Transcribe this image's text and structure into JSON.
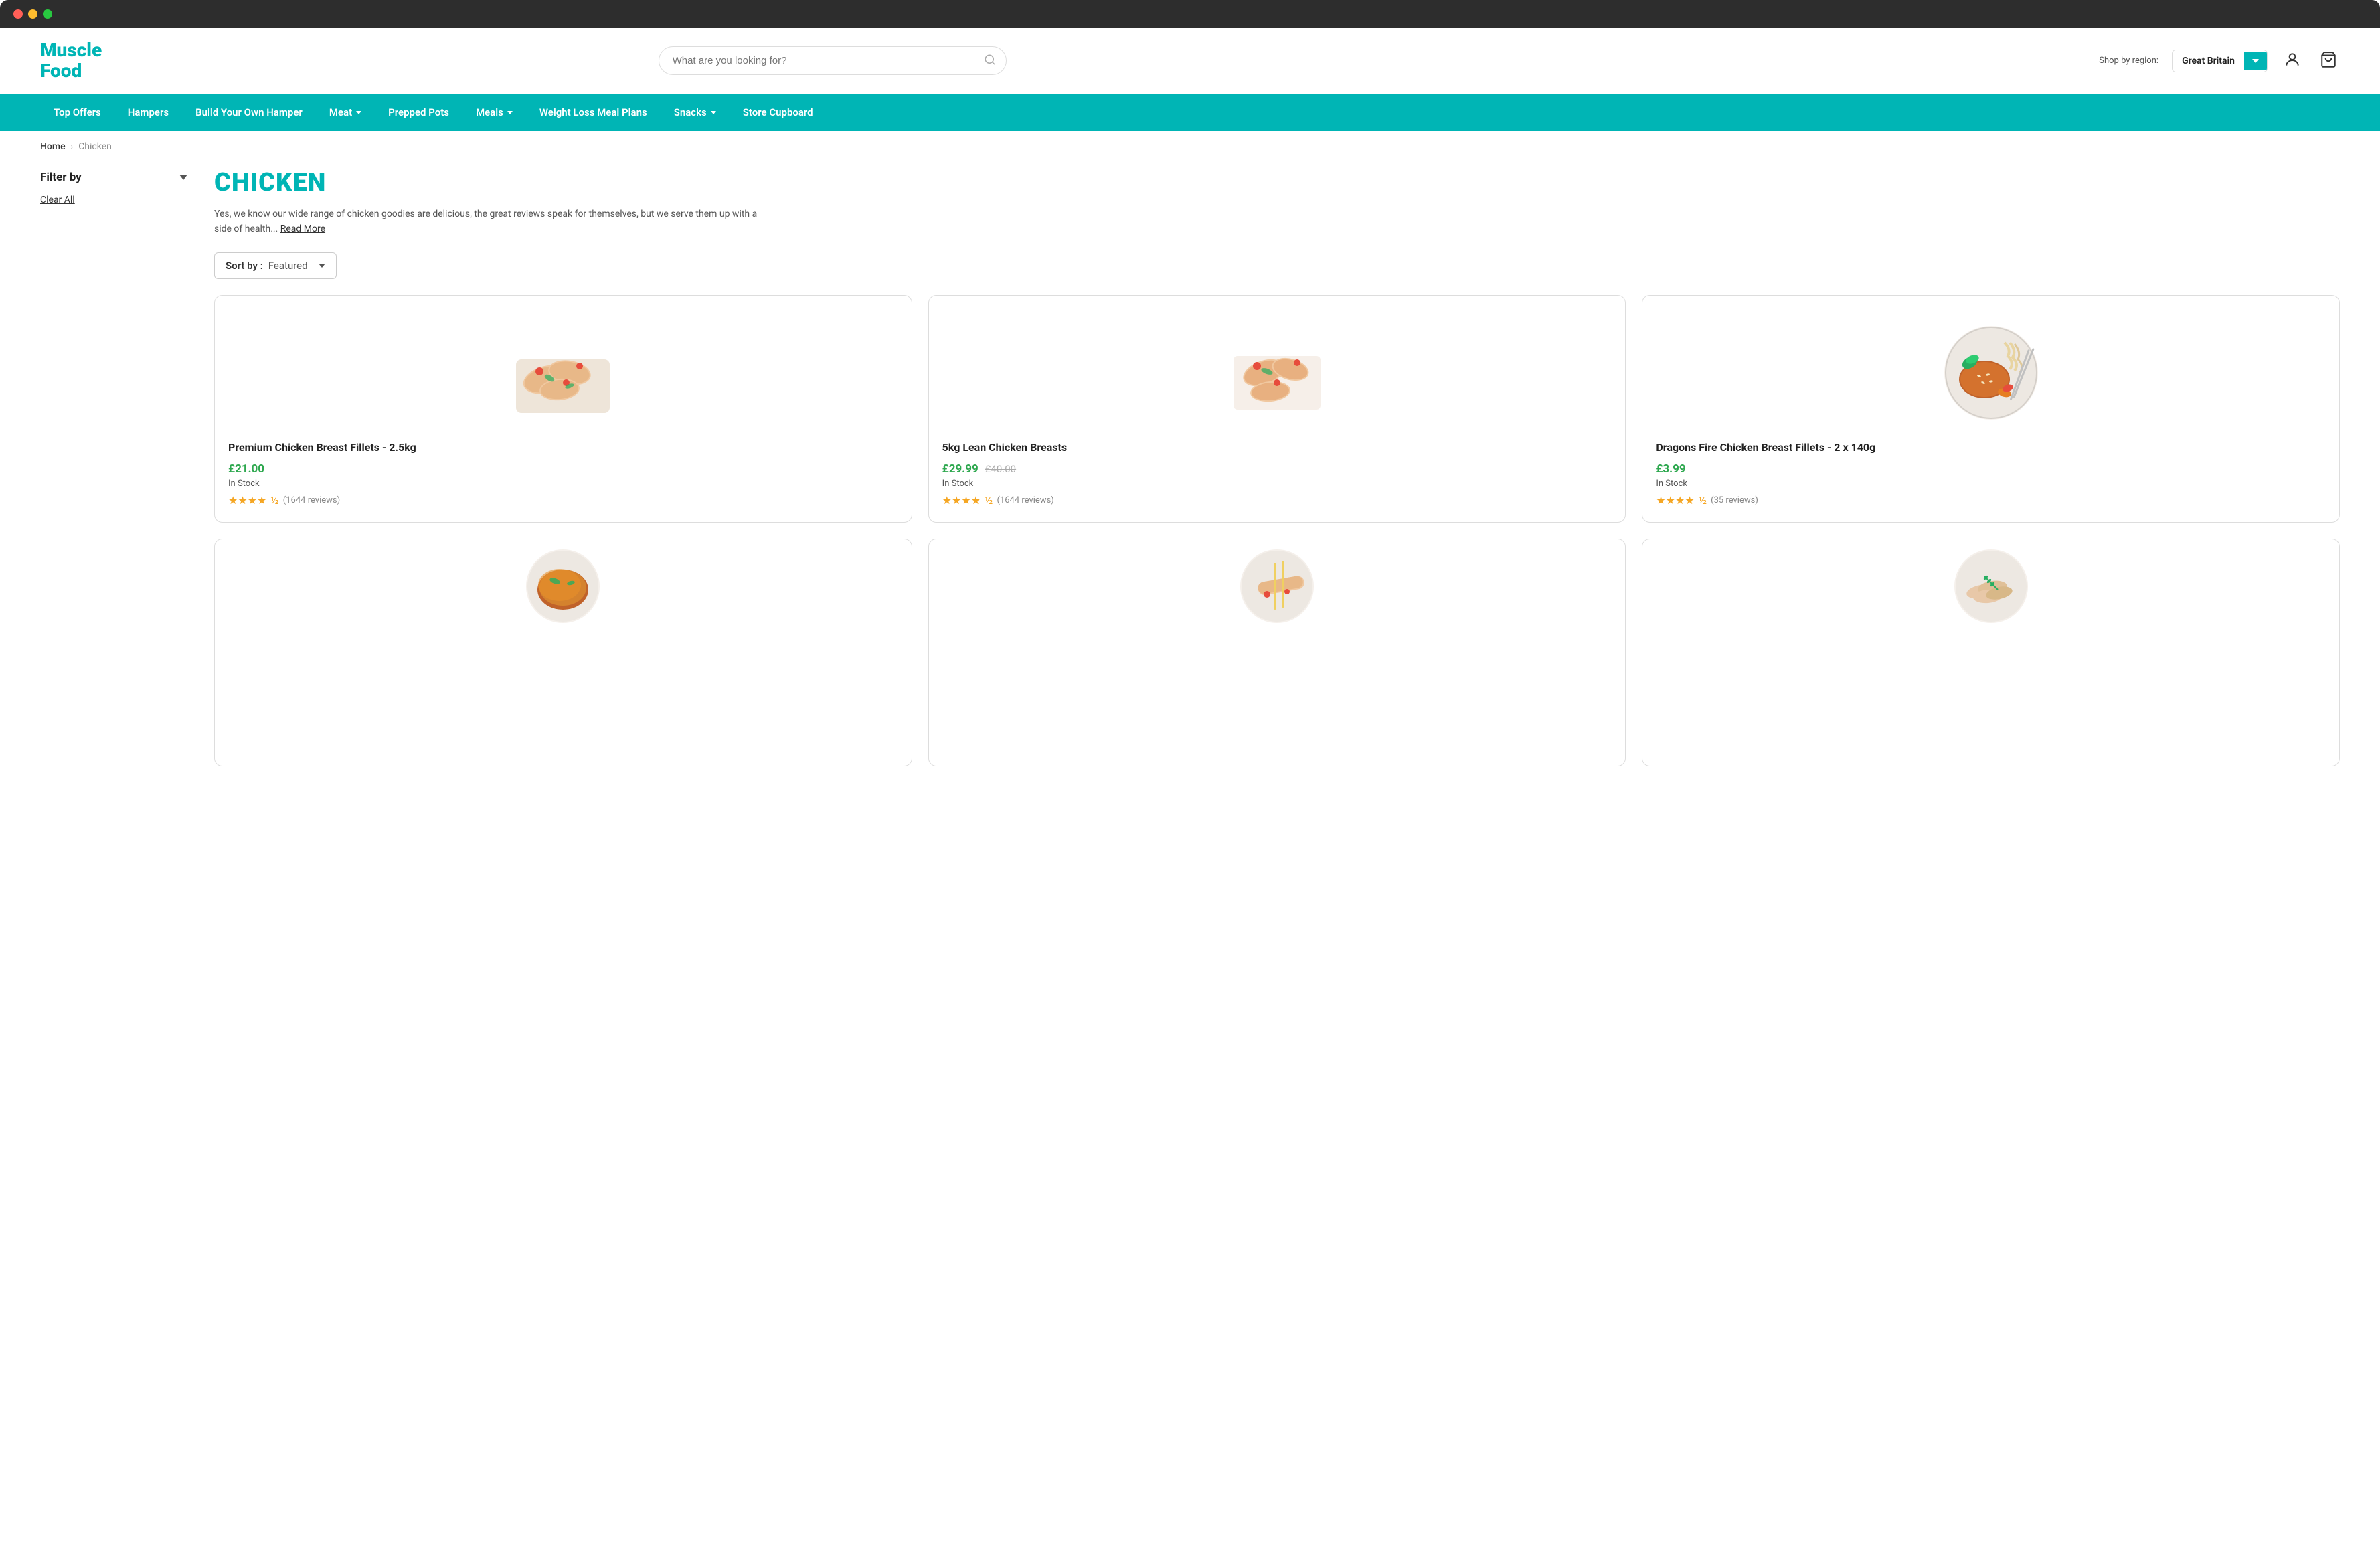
{
  "window": {
    "title": "MuscleFood - Chicken"
  },
  "header": {
    "logo_line1": "Muscle",
    "logo_line2": "Food",
    "search_placeholder": "What are you looking for?",
    "region_label": "Shop by region:",
    "region_name": "Great Britain",
    "region_dropdown_aria": "Change region"
  },
  "nav": {
    "items": [
      {
        "label": "Top Offers",
        "has_dropdown": false
      },
      {
        "label": "Hampers",
        "has_dropdown": false
      },
      {
        "label": "Build Your Own Hamper",
        "has_dropdown": false
      },
      {
        "label": "Meat",
        "has_dropdown": true
      },
      {
        "label": "Prepped Pots",
        "has_dropdown": false
      },
      {
        "label": "Meals",
        "has_dropdown": true
      },
      {
        "label": "Weight Loss Meal Plans",
        "has_dropdown": false
      },
      {
        "label": "Snacks",
        "has_dropdown": true
      },
      {
        "label": "Store Cupboard",
        "has_dropdown": false
      }
    ]
  },
  "breadcrumb": {
    "home_label": "Home",
    "current": "Chicken"
  },
  "sidebar": {
    "filter_label": "Filter by",
    "clear_all_label": "Clear All"
  },
  "product_area": {
    "page_title": "CHICKEN",
    "description": "Yes, we know our wide range of chicken goodies are delicious, the great reviews speak for themselves, but we serve them up with a side of health...",
    "read_more_label": "Read More",
    "sort_label": "Sort by :",
    "sort_value": "Featured",
    "products": [
      {
        "name": "Premium Chicken Breast Fillets - 2.5kg",
        "price": "£21.00",
        "price_original": "",
        "stock": "In Stock",
        "stars": 4.5,
        "reviews": 1644,
        "emoji": "🍗",
        "img_type": "fillets"
      },
      {
        "name": "5kg Lean Chicken Breasts",
        "price": "£29.99",
        "price_original": "£40.00",
        "stock": "In Stock",
        "stars": 4.5,
        "reviews": 1644,
        "emoji": "🍗",
        "img_type": "lean"
      },
      {
        "name": "Dragons Fire Chicken Breast Fillets - 2 x 140g",
        "price": "£3.99",
        "price_original": "",
        "stock": "In Stock",
        "stars": 4.5,
        "reviews": 35,
        "emoji": "🍽️",
        "img_type": "fire"
      }
    ],
    "bottom_row_emojis": [
      "🍛",
      "🍢",
      "🥩"
    ]
  }
}
